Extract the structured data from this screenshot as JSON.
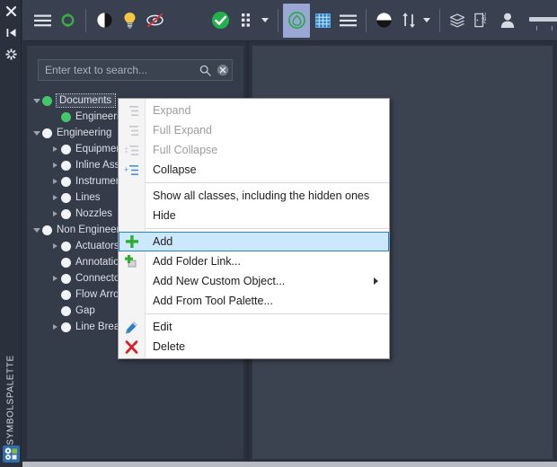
{
  "window": {
    "title": "Symbolspalette",
    "vertical_label": "SYMBOLSPALETTE"
  },
  "rail": {
    "icons": [
      {
        "name": "close-icon",
        "glyph": "close"
      },
      {
        "name": "dock-pin-icon",
        "glyph": "dock"
      },
      {
        "name": "settings-gear-icon",
        "glyph": "gear"
      }
    ],
    "bottom_icon": "symbol-palette-icon"
  },
  "toolbar": {
    "items": [
      {
        "name": "menu-button",
        "icon": "hamburger-menu-icon",
        "label": "Menu"
      },
      {
        "name": "refresh-button",
        "icon": "refresh-sync-icon",
        "label": "Refresh"
      },
      {
        "name": "contrast-button",
        "icon": "half-circle-icon",
        "label": "Contrast"
      },
      {
        "name": "lightbulb-button",
        "icon": "lightbulb-icon",
        "label": "Highlight"
      },
      {
        "name": "hidden-toggle-button",
        "icon": "eye-crossed-icon",
        "label": "Show hidden"
      },
      {
        "name": "validate-button",
        "icon": "green-check-circle-icon",
        "label": "Validate"
      },
      {
        "name": "grid-dots-button",
        "icon": "grid-dots-icon",
        "label": "Layout"
      },
      {
        "name": "symbol-view-button",
        "icon": "green-symbol-icon",
        "label": "Symbol view"
      },
      {
        "name": "table-view-button",
        "icon": "blue-grid-icon",
        "label": "Table view"
      },
      {
        "name": "list-view-button",
        "icon": "list-lines-icon",
        "label": "List view"
      },
      {
        "name": "contrast2-button",
        "icon": "half-circle-icon",
        "label": "Contrast"
      },
      {
        "name": "sort-button",
        "icon": "sort-updown-icon",
        "label": "Sort"
      },
      {
        "name": "layers-button",
        "icon": "layers-stack-icon",
        "label": "Layers"
      },
      {
        "name": "abc-label-button",
        "icon": "abc-label-icon",
        "label": "Labels"
      },
      {
        "name": "user-button",
        "icon": "person-icon",
        "label": "User"
      }
    ],
    "slider": {
      "name": "zoom-slider",
      "value": 50,
      "min": 0,
      "max": 100,
      "tick_count": 6
    },
    "accent_blue": "#1a7fd4",
    "accent_green": "#2cae2c",
    "active_highlight": "#9aa7d4"
  },
  "search": {
    "placeholder": "Enter text to search...",
    "value": "",
    "search_icon": "magnifier-icon",
    "clear_icon": "clear-circle-icon"
  },
  "tree": {
    "nodes": [
      {
        "label": "Documents",
        "indent": 0,
        "expander": "down",
        "bullet": "green",
        "selected": true
      },
      {
        "label": "Engineering",
        "indent": 1,
        "expander": "none",
        "bullet": "green",
        "selected": false
      },
      {
        "label": "Engineering",
        "indent": 0,
        "expander": "down",
        "bullet": "white",
        "selected": false
      },
      {
        "label": "Equipment",
        "indent": 1,
        "expander": "right",
        "bullet": "white",
        "selected": false
      },
      {
        "label": "Inline Assets",
        "indent": 1,
        "expander": "right",
        "bullet": "white",
        "selected": false
      },
      {
        "label": "Instrumentation",
        "indent": 1,
        "expander": "right",
        "bullet": "white",
        "selected": false
      },
      {
        "label": "Lines",
        "indent": 1,
        "expander": "right",
        "bullet": "white",
        "selected": false
      },
      {
        "label": "Nozzles",
        "indent": 1,
        "expander": "right",
        "bullet": "white",
        "selected": false
      },
      {
        "label": "Non Engineering",
        "indent": 0,
        "expander": "down",
        "bullet": "white",
        "selected": false
      },
      {
        "label": "Actuators",
        "indent": 1,
        "expander": "right",
        "bullet": "white",
        "selected": false
      },
      {
        "label": "Annotation",
        "indent": 1,
        "expander": "none",
        "bullet": "white",
        "selected": false
      },
      {
        "label": "Connectors",
        "indent": 1,
        "expander": "right",
        "bullet": "white",
        "selected": false
      },
      {
        "label": "Flow Arrows",
        "indent": 1,
        "expander": "none",
        "bullet": "white",
        "selected": false
      },
      {
        "label": "Gap",
        "indent": 1,
        "expander": "none",
        "bullet": "white",
        "selected": false
      },
      {
        "label": "Line Breaks",
        "indent": 1,
        "expander": "right",
        "bullet": "white",
        "selected": false
      }
    ]
  },
  "context_menu": {
    "items": [
      {
        "label": "Expand",
        "icon": "expand-icon",
        "disabled": true,
        "highlight": false,
        "submenu": false
      },
      {
        "label": "Full Expand",
        "icon": "full-expand-icon",
        "disabled": true,
        "highlight": false,
        "submenu": false
      },
      {
        "label": "Full Collapse",
        "icon": "full-collapse-icon",
        "disabled": true,
        "highlight": false,
        "submenu": false
      },
      {
        "label": "Collapse",
        "icon": "collapse-icon",
        "disabled": false,
        "highlight": false,
        "submenu": false
      },
      {
        "separator": true
      },
      {
        "label": "Show all classes, including the hidden ones",
        "icon": "none",
        "disabled": false,
        "highlight": false,
        "submenu": false
      },
      {
        "label": "Hide",
        "icon": "none",
        "disabled": false,
        "highlight": false,
        "submenu": false
      },
      {
        "separator": true
      },
      {
        "label": "Add",
        "icon": "plus-green-icon",
        "disabled": false,
        "highlight": true,
        "submenu": false
      },
      {
        "label": "Add Folder Link...",
        "icon": "add-folder-link-icon",
        "disabled": false,
        "highlight": false,
        "submenu": false
      },
      {
        "label": "Add New Custom Object...",
        "icon": "none",
        "disabled": false,
        "highlight": false,
        "submenu": true
      },
      {
        "label": "Add From Tool Palette...",
        "icon": "none",
        "disabled": false,
        "highlight": false,
        "submenu": false
      },
      {
        "separator": true
      },
      {
        "label": "Edit",
        "icon": "pencil-icon",
        "disabled": false,
        "highlight": false,
        "submenu": false
      },
      {
        "label": "Delete",
        "icon": "red-x-icon",
        "disabled": false,
        "highlight": false,
        "submenu": false
      }
    ]
  }
}
